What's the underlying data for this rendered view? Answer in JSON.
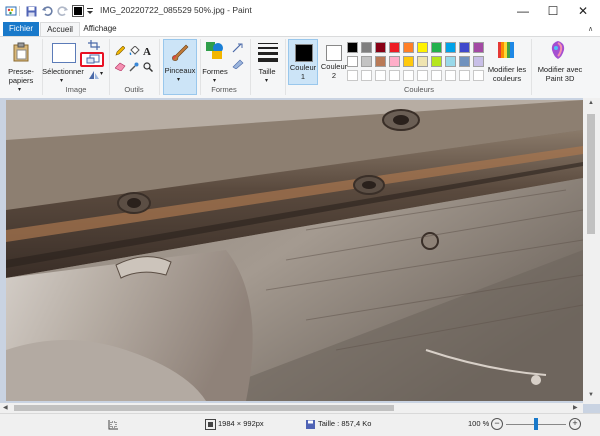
{
  "window": {
    "title": "IMG_20220722_085529 50%.jpg - Paint",
    "minimize": "—",
    "maximize": "☐",
    "close": "✕"
  },
  "tabs": [
    {
      "label": "Fichier"
    },
    {
      "label": "Accueil"
    },
    {
      "label": "Affichage"
    }
  ],
  "ribbon": {
    "clipboard": {
      "label_line1": "Presse-",
      "label_line2": "papiers"
    },
    "image": {
      "select_label": "Sélectionner",
      "group": "Image"
    },
    "tools": {
      "group": "Outils"
    },
    "brushes": {
      "label": "Pinceaux"
    },
    "shapes": {
      "label": "Formes",
      "group": "Formes"
    },
    "size": {
      "label": "Taille"
    },
    "color1": {
      "line1": "Couleur",
      "line2": "1"
    },
    "color2": {
      "line1": "Couleur",
      "line2": "2"
    },
    "colors": {
      "group": "Couleurs"
    },
    "edit_colors": {
      "line1": "Modifier les",
      "line2": "couleurs"
    },
    "paint3d": {
      "line1": "Modifier avec",
      "line2": "Paint 3D"
    },
    "palette": [
      "#000000",
      "#7f7f7f",
      "#880015",
      "#ed1c24",
      "#ff7f27",
      "#fff200",
      "#22b14c",
      "#00a2e8",
      "#3f48cc",
      "#a349a4",
      "#ffffff",
      "#c3c3c3",
      "#b97a57",
      "#ffaec9",
      "#ffc90e",
      "#efe4b0",
      "#b5e61d",
      "#99d9ea",
      "#7092be",
      "#c8bfe7"
    ],
    "highlight_color": "#e81123"
  },
  "status": {
    "dimensions": "1984 × 992px",
    "size": "Taille : 857,4 Ko",
    "zoom": "100 %",
    "zoom_level": 0.5
  }
}
